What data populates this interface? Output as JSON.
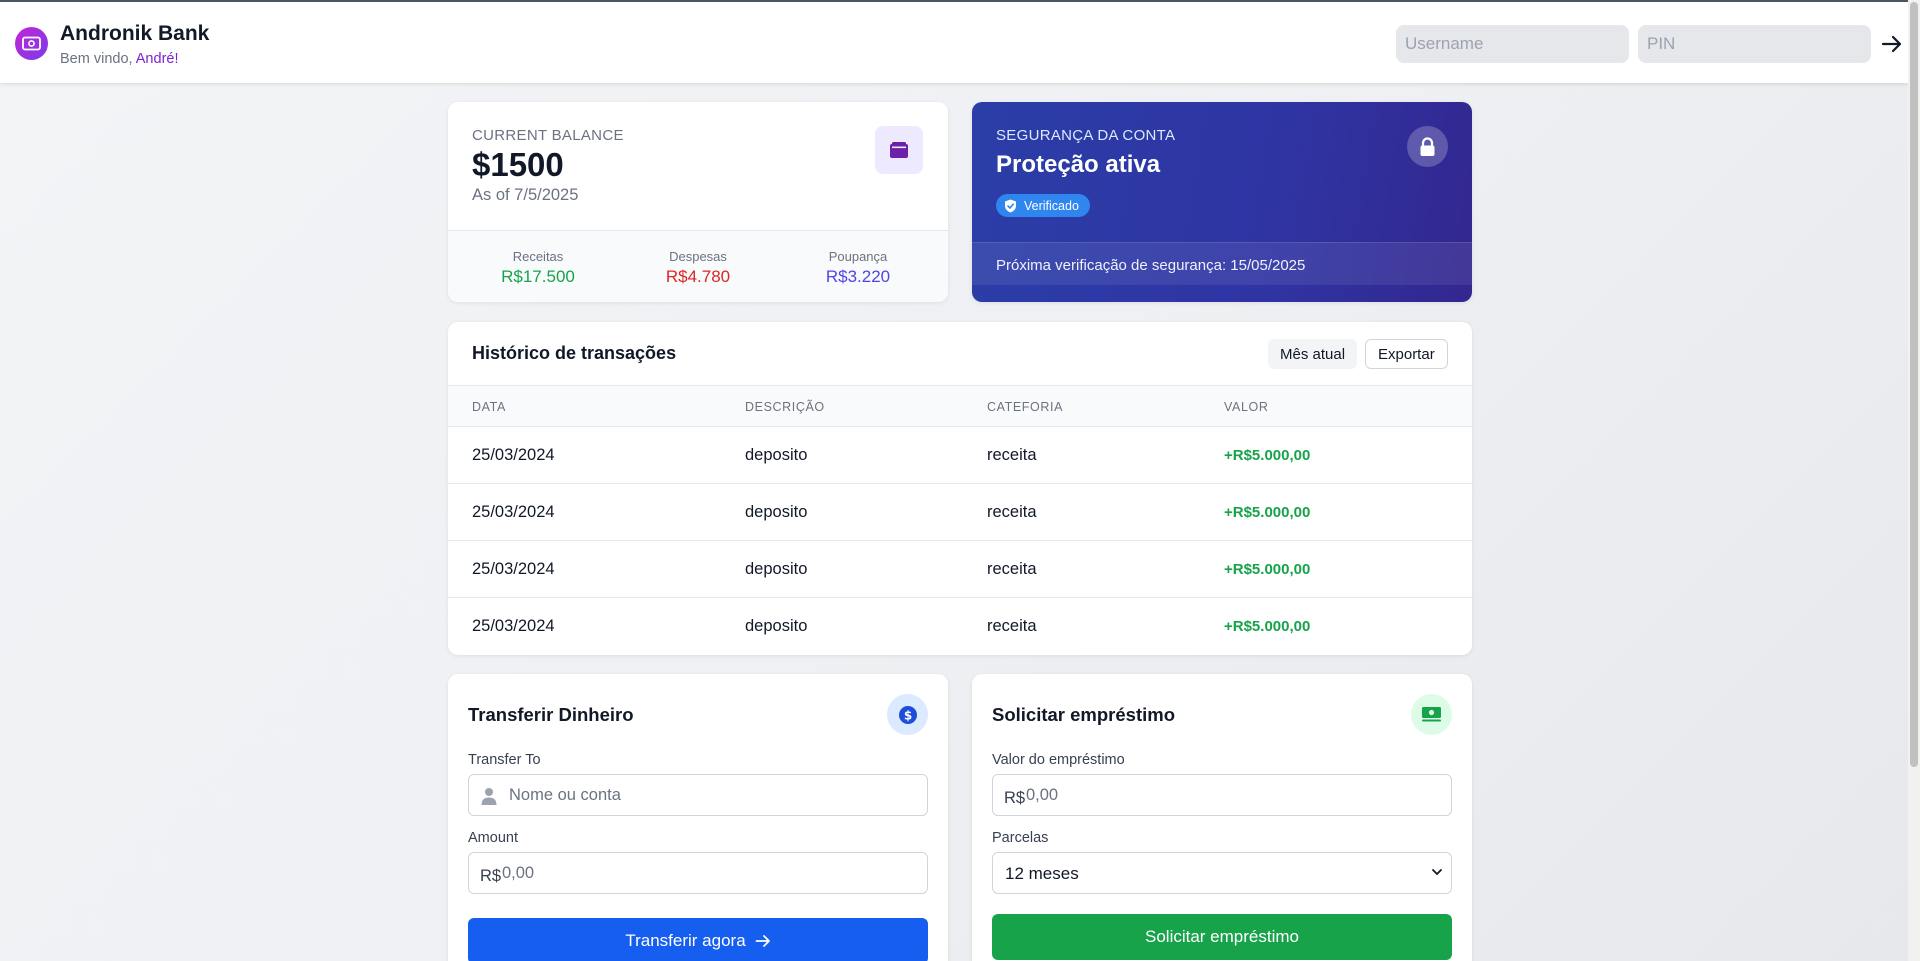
{
  "header": {
    "brand": "Andronik Bank",
    "welcome_prefix": "Bem vindo, ",
    "welcome_user": "André!",
    "username_placeholder": "Username",
    "pin_placeholder": "PIN"
  },
  "balance": {
    "label": "CURRENT BALANCE",
    "amount": "$1500",
    "as_of": "As of 7/5/2025",
    "stats": [
      {
        "label": "Receitas",
        "value": "R$17.500"
      },
      {
        "label": "Despesas",
        "value": "R$4.780"
      },
      {
        "label": "Poupança",
        "value": "R$3.220"
      }
    ]
  },
  "security": {
    "label": "SEGURANÇA DA CONTA",
    "title": "Proteção ativa",
    "badge": "Verificado",
    "next_check": "Próxima verificação de segurança: 15/05/2025"
  },
  "transactions": {
    "title": "Histórico de transações",
    "filter_button": "Mês atual",
    "export_button": "Exportar",
    "columns": [
      "DATA",
      "DESCRIÇÃO",
      "CATEFORIA",
      "VALOR"
    ],
    "rows": [
      {
        "date": "25/03/2024",
        "description": "deposito",
        "category": "receita",
        "value": "+R$5.000,00"
      },
      {
        "date": "25/03/2024",
        "description": "deposito",
        "category": "receita",
        "value": "+R$5.000,00"
      },
      {
        "date": "25/03/2024",
        "description": "deposito",
        "category": "receita",
        "value": "+R$5.000,00"
      },
      {
        "date": "25/03/2024",
        "description": "deposito",
        "category": "receita",
        "value": "+R$5.000,00"
      }
    ]
  },
  "transfer": {
    "title": "Transferir Dinheiro",
    "to_label": "Transfer To",
    "to_placeholder": "Nome ou conta",
    "amount_label": "Amount",
    "currency_prefix": "R$",
    "amount_placeholder": "0,00",
    "button": "Transferir agora"
  },
  "loan": {
    "title": "Solicitar empréstimo",
    "amount_label": "Valor do empréstimo",
    "currency_prefix": "R$",
    "amount_placeholder": "0,00",
    "installments_label": "Parcelas",
    "installments_value": "12 meses",
    "button": "Solicitar empréstimo"
  },
  "colors": {
    "accent_purple": "#7e22ce",
    "positive": "#16a34a",
    "negative": "#dc2626",
    "savings": "#4f46e5",
    "primary_blue": "#155eef",
    "security_gradient_start": "#2b3ea8",
    "security_gradient_end": "#33278f"
  },
  "icons": {
    "logo": "banknote-icon",
    "login_submit": "arrow-right-icon",
    "balance": "wallet-icon",
    "security": "lock-icon",
    "badge": "shield-check-icon",
    "transfer": "dollar-circle-icon",
    "transfer_to": "user-icon",
    "transfer_button": "arrow-right-icon",
    "loan": "money-bill-icon",
    "select": "chevron-down-icon"
  }
}
